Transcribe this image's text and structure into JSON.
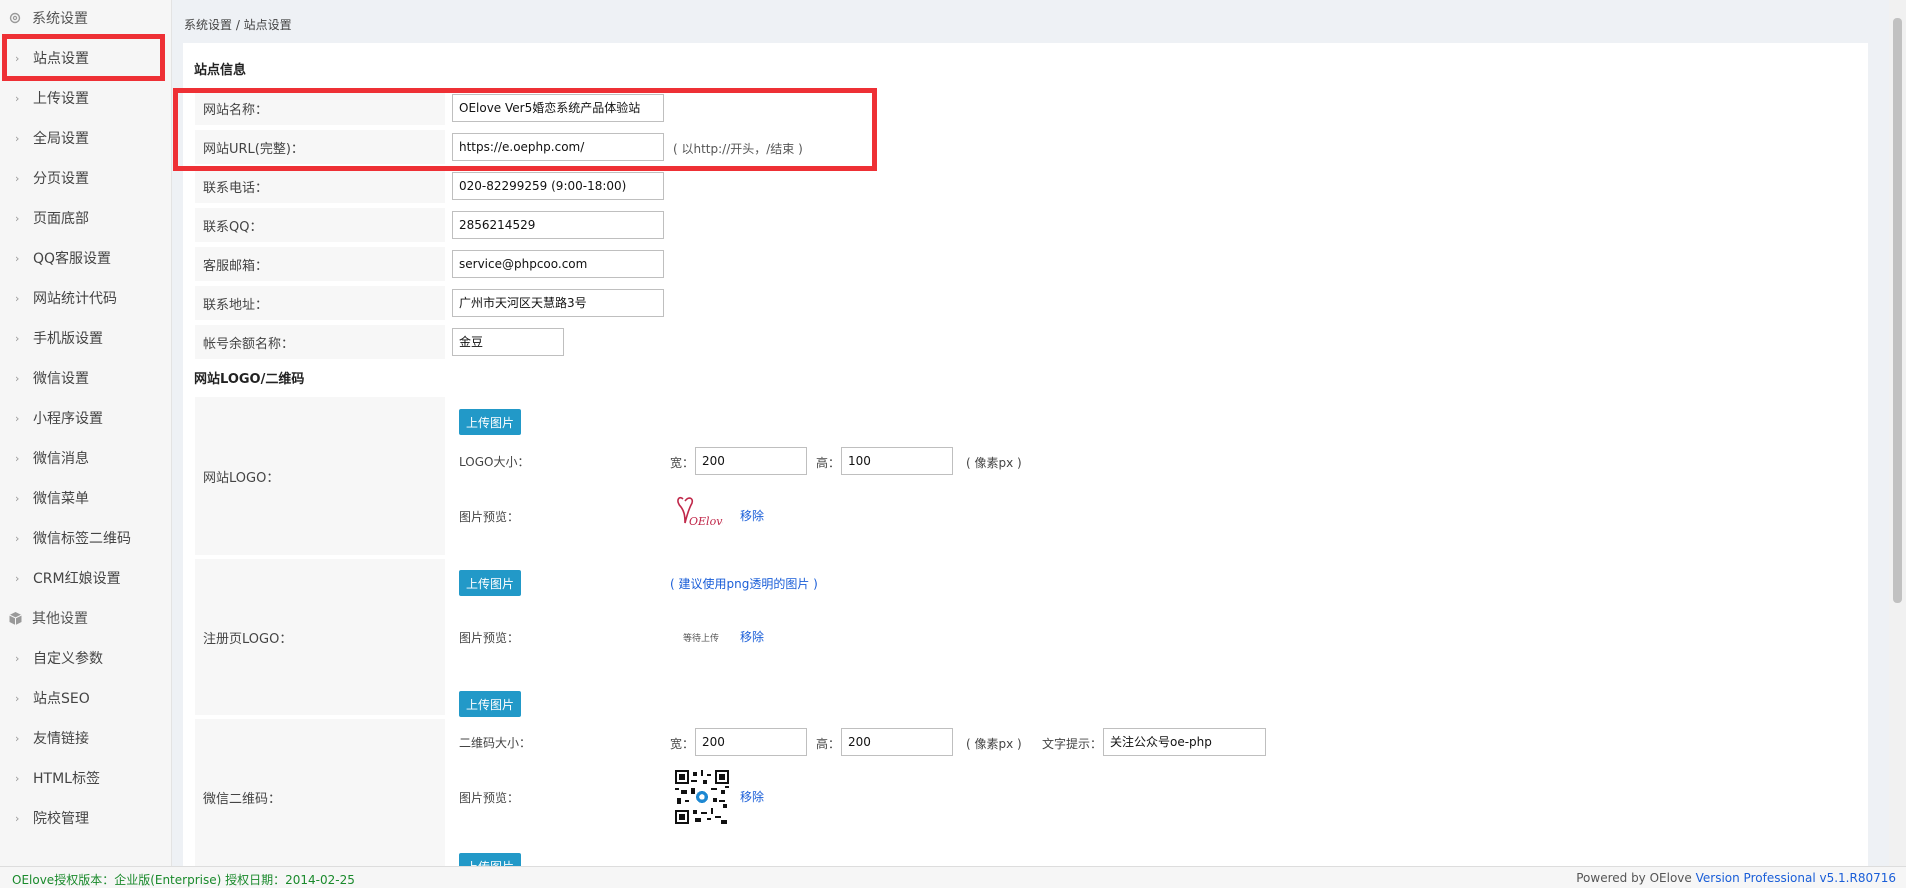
{
  "breadcrumb": "系统设置 / 站点设置",
  "sidebar": {
    "group1": "系统设置",
    "group2": "其他设置",
    "items": [
      "站点设置",
      "上传设置",
      "全局设置",
      "分页设置",
      "页面底部",
      "QQ客服设置",
      "网站统计代码",
      "手机版设置",
      "微信设置",
      "小程序设置",
      "微信消息",
      "微信菜单",
      "微信标签二维码",
      "CRM红娘设置"
    ],
    "items2": [
      "自定义参数",
      "站点SEO",
      "友情链接",
      "HTML标签",
      "院校管理"
    ]
  },
  "site_info": {
    "title": "站点信息",
    "fields": [
      {
        "label": "网站名称：",
        "value": "OElove Ver5婚恋系统产品体验站"
      },
      {
        "label": "网站URL(完整)：",
        "value": "https://e.oephp.com/",
        "hint": "( 以http://开头，/结束 )"
      },
      {
        "label": "联系电话：",
        "value": "020-82299259 (9:00-18:00)"
      },
      {
        "label": "联系QQ：",
        "value": "2856214529"
      },
      {
        "label": "客服邮箱：",
        "value": "service@phpcoo.com"
      },
      {
        "label": "联系地址：",
        "value": "广州市天河区天慧路3号"
      },
      {
        "label": "帐号余额名称：",
        "value": "金豆"
      }
    ]
  },
  "logo_section": {
    "title": "网站LOGO/二维码",
    "upload_label": "上传图片",
    "site_logo": {
      "label": "网站LOGO：",
      "size_label": "LOGO大小：",
      "width_label": "宽：",
      "width": "200",
      "height_label": "高：",
      "height": "100",
      "unit": "( 像素px )",
      "preview_label": "图片预览：",
      "preview_text": "OElove",
      "remove": "移除"
    },
    "reg_logo": {
      "label": "注册页LOGO：",
      "hint": "( 建议使用png透明的图片 )",
      "preview_label": "图片预览：",
      "preview_text": "等待上传",
      "remove": "移除"
    },
    "wechat_qr": {
      "label": "微信二维码：",
      "size_label": "二维码大小：",
      "width_label": "宽：",
      "width": "200",
      "height_label": "高：",
      "height": "200",
      "unit": "( 像素px )",
      "text_hint_label": "文字提示：",
      "text_hint": "关注公众号oe-php",
      "preview_label": "图片预览：",
      "remove": "移除"
    }
  },
  "footer": {
    "left": "OElove授权版本：企业版(Enterprise) 授权日期：2014-02-25",
    "right_prefix": "Powered by OElove ",
    "right_version": "Version Professional v5.1.R80716"
  },
  "colors": {
    "accent": "#2299c8",
    "highlight": "#ee3035",
    "link": "#1a5ed8",
    "footer_green": "#1a8a2c"
  }
}
